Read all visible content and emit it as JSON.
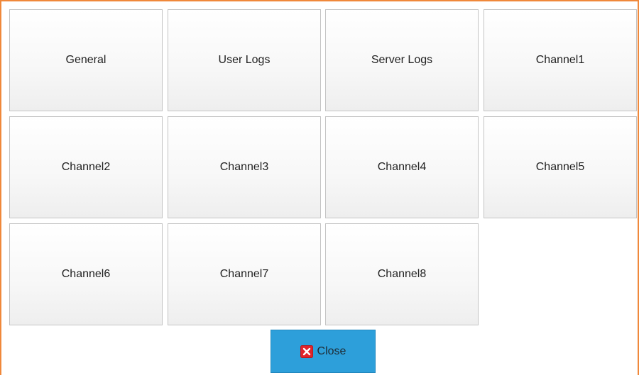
{
  "tiles": [
    {
      "label": "General"
    },
    {
      "label": "User Logs"
    },
    {
      "label": "Server Logs"
    },
    {
      "label": "Channel1"
    },
    {
      "label": "Channel2"
    },
    {
      "label": "Channel3"
    },
    {
      "label": "Channel4"
    },
    {
      "label": "Channel5"
    },
    {
      "label": "Channel6"
    },
    {
      "label": "Channel7"
    },
    {
      "label": "Channel8"
    }
  ],
  "close_button": {
    "label": "Close",
    "icon": "close-icon",
    "background_color": "#2d9fda",
    "icon_color": "#e0242a"
  },
  "colors": {
    "dialog_border": "#f0883a"
  }
}
